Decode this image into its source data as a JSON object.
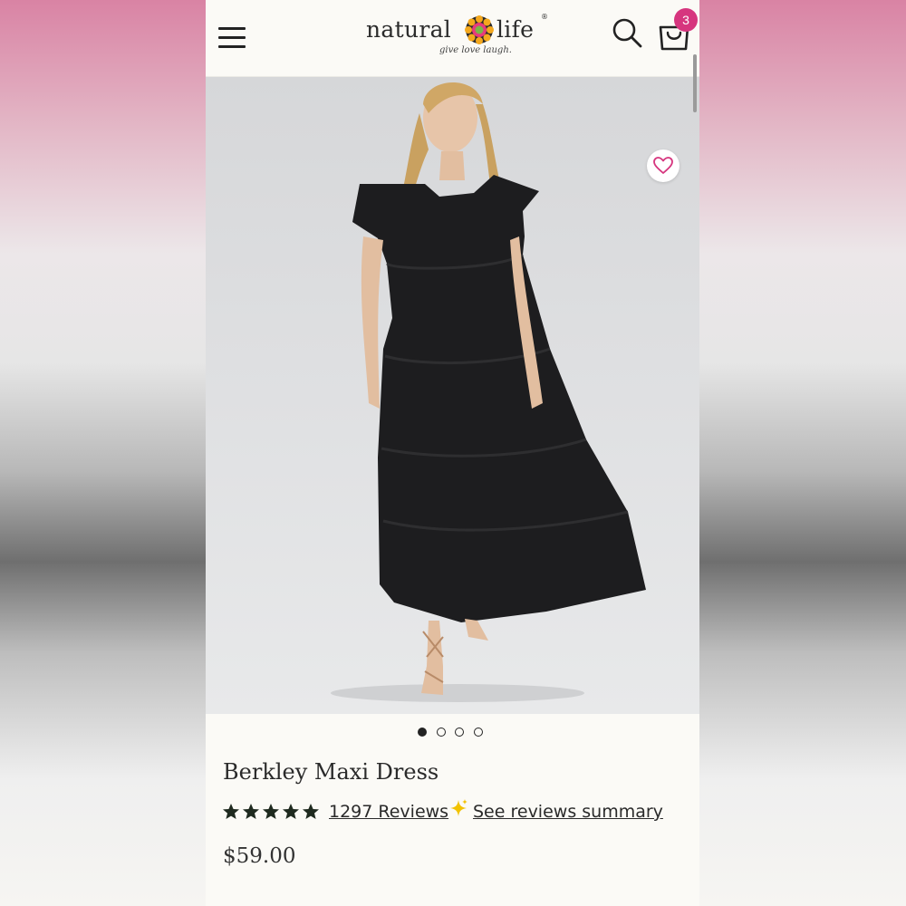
{
  "header": {
    "menu_icon": "hamburger-menu-icon",
    "logo": {
      "brand_left": "natural",
      "brand_right": "life",
      "registered": "®",
      "tagline": "give love laugh."
    },
    "search_icon": "search-icon",
    "cart_icon": "shopping-bag-icon",
    "cart_count": "3",
    "badge_color": "#d6357e"
  },
  "gallery": {
    "favorite_icon": "heart-outline-icon",
    "favorite_color": "#d6357e",
    "image_count": 4,
    "active_index": 0
  },
  "product": {
    "name": "Berkley Maxi Dress",
    "rating": 5,
    "rating_max": 5,
    "reviews_label": "1297 Reviews",
    "summary_icon": "sparkle-icon",
    "summary_label": "See reviews summary",
    "price": "$59.00"
  },
  "colors": {
    "page_background": "#fbfaf6",
    "text": "#2a2a2a",
    "accent": "#d6357e",
    "sparkle": "#f2c200"
  }
}
